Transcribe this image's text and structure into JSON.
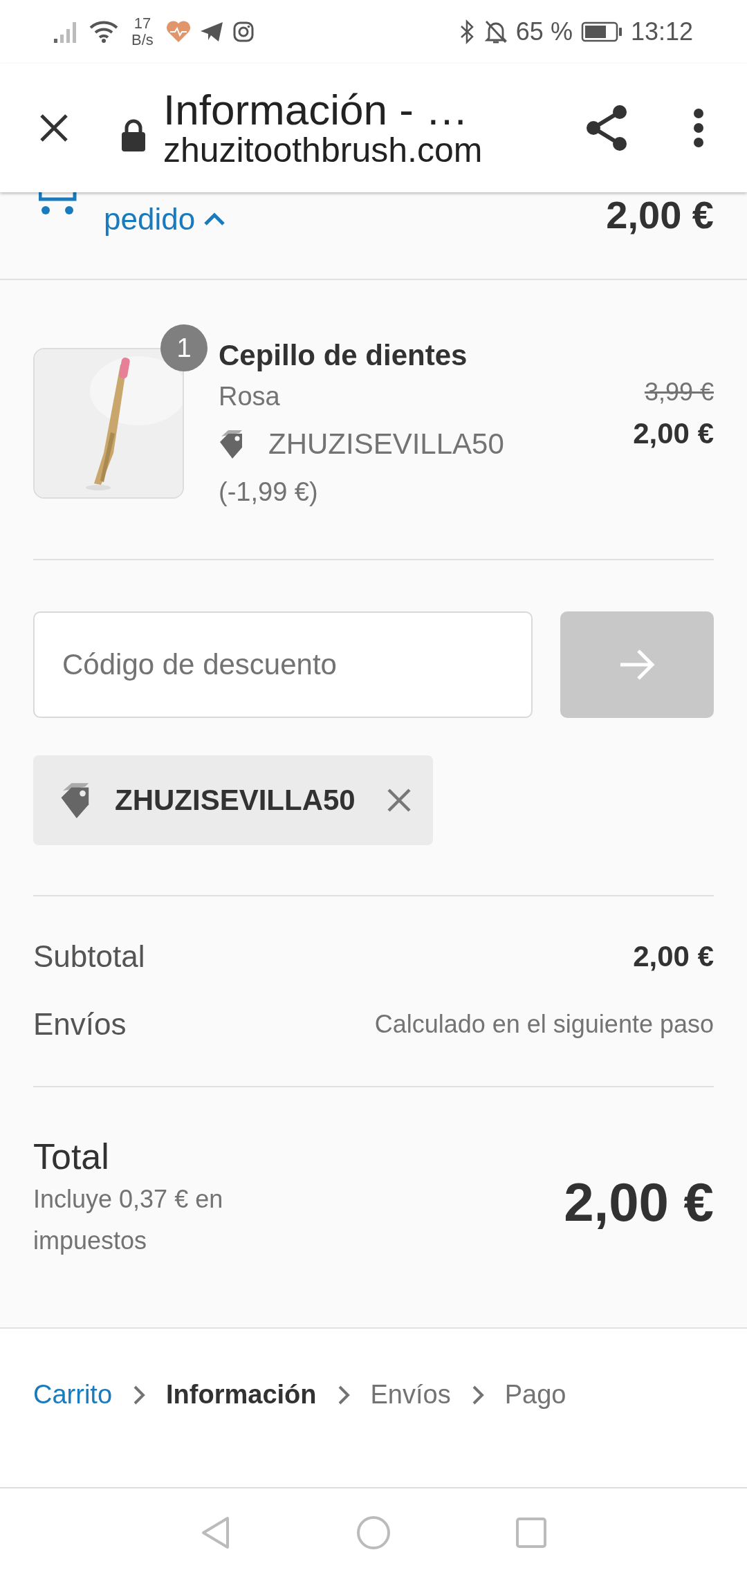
{
  "status_bar": {
    "speed_value": "17",
    "speed_unit": "B/s",
    "battery": "65 %",
    "time": "13:12"
  },
  "browser": {
    "title": "Información - …",
    "url": "zhuzitoothbrush.com"
  },
  "order_summary": {
    "label": "pedido",
    "expanded": true,
    "total": "2,00 €"
  },
  "items": [
    {
      "quantity": "1",
      "name": "Cepillo de dientes",
      "variant": "Rosa",
      "discount_code": "ZHUZISEVILLA50",
      "discount_amount": "(-1,99 €)",
      "original_price": "3,99 €",
      "price": "2,00 €"
    }
  ],
  "discount": {
    "placeholder": "Código de descuento",
    "apply_disabled": true
  },
  "applied_codes": [
    {
      "code": "ZHUZISEVILLA50"
    }
  ],
  "totals": [
    {
      "label": "Subtotal",
      "value": "2,00 €",
      "kind": "amount"
    },
    {
      "label": "Envíos",
      "value": "Calculado en el siguiente paso",
      "kind": "note"
    }
  ],
  "total": {
    "label": "Total",
    "taxes_note": "Incluye 0,37 € en impuestos",
    "value": "2,00 €"
  },
  "breadcrumb": [
    {
      "label": "Carrito",
      "kind": "link"
    },
    {
      "label": "Información",
      "kind": "current"
    },
    {
      "label": "Envíos",
      "kind": "upcoming"
    },
    {
      "label": "Pago",
      "kind": "upcoming"
    }
  ]
}
